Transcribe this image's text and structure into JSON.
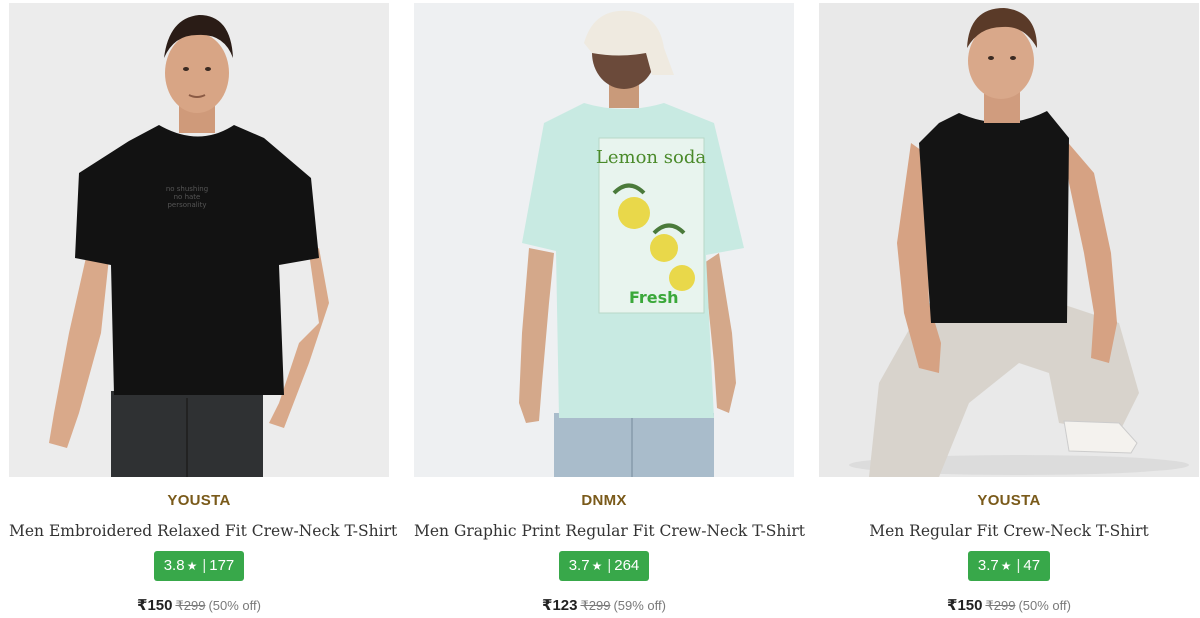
{
  "products": [
    {
      "brand": "YOUSTA",
      "title": "Men Embroidered Relaxed Fit Crew-Neck T-Shirt",
      "rating": "3.8",
      "rating_count": "177",
      "price": "₹150",
      "mrp": "₹299",
      "discount": "(50% off)",
      "print_text": "no shushing\nno hate\npersonality"
    },
    {
      "brand": "DNMX",
      "title": "Men Graphic Print Regular Fit Crew-Neck T-Shirt",
      "rating": "3.7",
      "rating_count": "264",
      "price": "₹123",
      "mrp": "₹299",
      "discount": "(59% off)",
      "print_text": "Lemon soda"
    },
    {
      "brand": "YOUSTA",
      "title": "Men Regular Fit Crew-Neck T-Shirt",
      "rating": "3.7",
      "rating_count": "47",
      "price": "₹150",
      "mrp": "₹299",
      "discount": "(50% off)"
    }
  ],
  "colors": {
    "brand_text": "#7a5a1a",
    "rating_badge": "#38a84a",
    "image_bg": "#ececec"
  },
  "icons": {
    "star": "star-icon"
  }
}
